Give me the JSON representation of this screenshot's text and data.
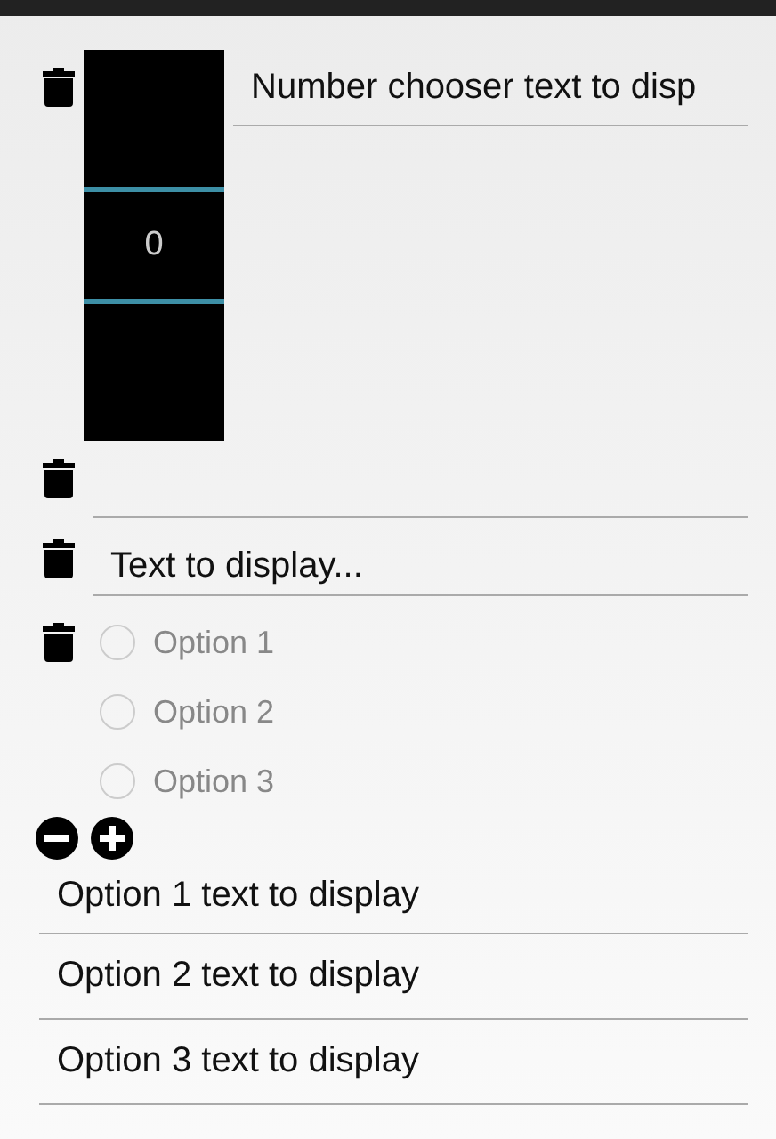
{
  "rows": [
    {
      "kind": "number",
      "value": "0",
      "field": {
        "value": "Number chooser text to disp"
      }
    },
    {
      "kind": "text"
    },
    {
      "kind": "text",
      "value": "Text to display..."
    },
    {
      "kind": "radio",
      "options": [
        {
          "label": "Option 1",
          "selected": false
        },
        {
          "label": "Option 2",
          "selected": false
        },
        {
          "label": "Option 3",
          "selected": false
        }
      ]
    }
  ],
  "option_fields": [
    {
      "value": "Option 1 text to display"
    },
    {
      "value": "Option 2 text to display"
    },
    {
      "value": "Option 3 text to display"
    }
  ]
}
